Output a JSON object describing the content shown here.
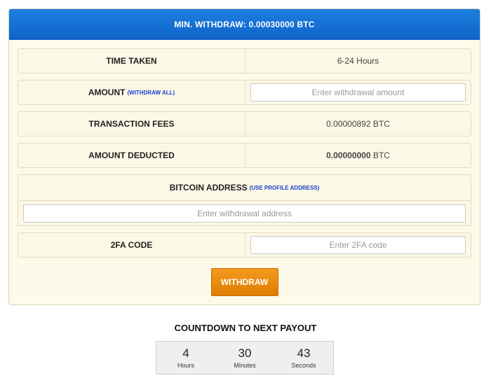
{
  "header": {
    "title": "MIN. WITHDRAW: 0.00030000 BTC"
  },
  "rows": {
    "time_taken": {
      "label": "TIME TAKEN",
      "value": "6-24 Hours"
    },
    "amount": {
      "label": "AMOUNT",
      "link": "(WITHDRAW ALL)",
      "placeholder": "Enter withdrawal amount"
    },
    "fees": {
      "label": "TRANSACTION FEES",
      "value": "0.00000892 BTC"
    },
    "deducted": {
      "label": "AMOUNT DEDUCTED",
      "value_bold": "0.00000000",
      "unit": "BTC"
    },
    "address": {
      "label": "BITCOIN ADDRESS",
      "link": "(USE PROFILE ADDRESS)",
      "placeholder": "Enter withdrawal address"
    },
    "twofa": {
      "label": "2FA CODE",
      "placeholder": "Enter 2FA code"
    }
  },
  "withdraw_button": "WITHDRAW",
  "countdown": {
    "title": "COUNTDOWN TO NEXT PAYOUT",
    "hours": "4",
    "hours_label": "Hours",
    "minutes": "30",
    "minutes_label": "Minutes",
    "seconds": "43",
    "seconds_label": "Seconds"
  },
  "colors": {
    "header_blue": "#0e63c8",
    "panel_bg": "#fdfae9",
    "button_orange": "#e07d00",
    "link_blue": "#1a3fcf"
  }
}
